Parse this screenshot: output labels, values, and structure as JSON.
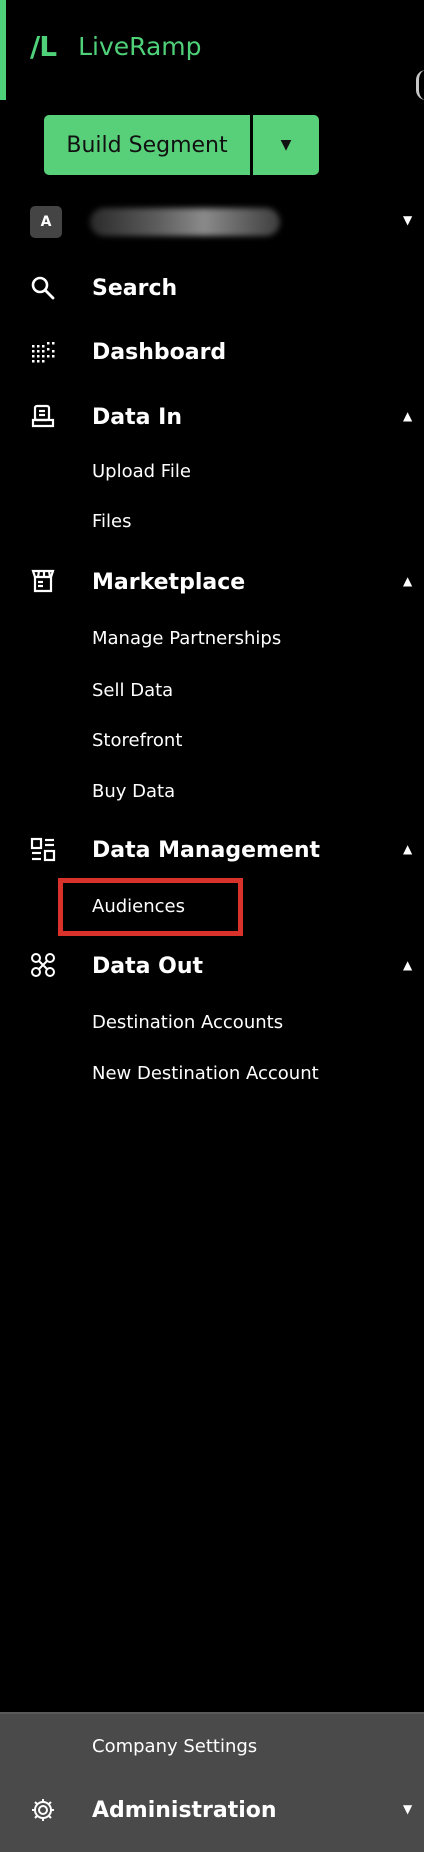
{
  "brand": {
    "mark": "/L",
    "name": "LiveRamp"
  },
  "build_segment": {
    "label": "Build Segment",
    "dropdown_symbol": "▼"
  },
  "account": {
    "initial": "A"
  },
  "nav": [
    {
      "label": "Search",
      "icon": "search-icon"
    },
    {
      "label": "Dashboard",
      "icon": "dashboard-icon"
    },
    {
      "label": "Data In",
      "icon": "data-in-icon",
      "sub": [
        "Upload File",
        "Files"
      ]
    },
    {
      "label": "Marketplace",
      "icon": "marketplace-icon",
      "sub": [
        "Manage Partnerships",
        "Sell Data",
        "Storefront",
        "Buy Data"
      ]
    },
    {
      "label": "Data Management",
      "icon": "data-management-icon",
      "sub": [
        "Audiences"
      ]
    },
    {
      "label": "Data Out",
      "icon": "data-out-icon",
      "sub": [
        "Destination Accounts",
        "New Destination Account"
      ]
    }
  ],
  "bottom": {
    "company_settings": "Company Settings",
    "administration": "Administration"
  },
  "colors": {
    "accent": "#58cf79",
    "highlight": "#d9322b",
    "bottom_panel": "#4a4a4a"
  }
}
